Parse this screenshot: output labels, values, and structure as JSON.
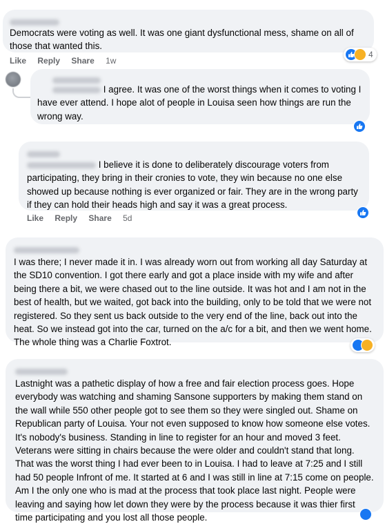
{
  "comments": [
    {
      "text": "Democrats were voting as well. It was one giant dysfunctional mess, shame on all of those that wanted this.",
      "actions": {
        "like": "Like",
        "reply": "Reply",
        "share": "Share",
        "time": "1w"
      },
      "reaction_count": "4"
    },
    {
      "inline_text": "I agree. It was one of the worst things when it comes to voting I",
      "text_rest": "have ever attend. I hope alot of people in Louisa seen how things are run the wrong way."
    },
    {
      "inline_text": "I believe it is done to deliberately discourage voters from",
      "text_rest": "participating, they bring in their cronies to vote, they win because no one else showed up because nothing is ever organized or fair. They are in the wrong party if they can hold their heads high and say it was a great process.",
      "actions": {
        "like": "Like",
        "reply": "Reply",
        "share": "Share",
        "time": "5d"
      }
    },
    {
      "text": "I was there; I never made it in. I was already worn out from working all day Saturday at the SD10 convention. I got there early and got a place inside with my wife and after being there a bit, we were chased out to the line outside. It was hot and I am not in the best of health, but we waited, got back into the building, only to be told that we were not registered. So they sent us back outside to the very end of the line, back out into the heat. So we instead got into the car, turned on the a/c for a bit, and then we went home. The whole thing was a Charlie Foxtrot."
    },
    {
      "text": "Lastnight was a pathetic display of how a free and fair election process goes. Hope everybody was watching and shaming Sansone supporters by making them stand on the wall while 550 other people got to see them so they were singled out. Shame on Republican party of Louisa. Your not even supposed to know how someone else votes. It's nobody's business. Standing in line to register for an hour and moved 3 feet. Veterans were sitting in chairs because the were older and couldn't stand that long. That was the worst thing I had ever been to in Louisa. I had to leave at 7:25 and I still had 50 people Infront of me. It started at 6 and I was still in line at 7:15 come on people. Am I the only one who is mad at the process that took place last night. People were leaving and saying how let down they were by the process because it was thier first time participating and you lost all those people."
    }
  ],
  "colors": {
    "bubble": "#f0f2f5",
    "like_blue": "#1877f2",
    "haha_yellow": "#f7b125",
    "meta_gray": "#65676b"
  }
}
